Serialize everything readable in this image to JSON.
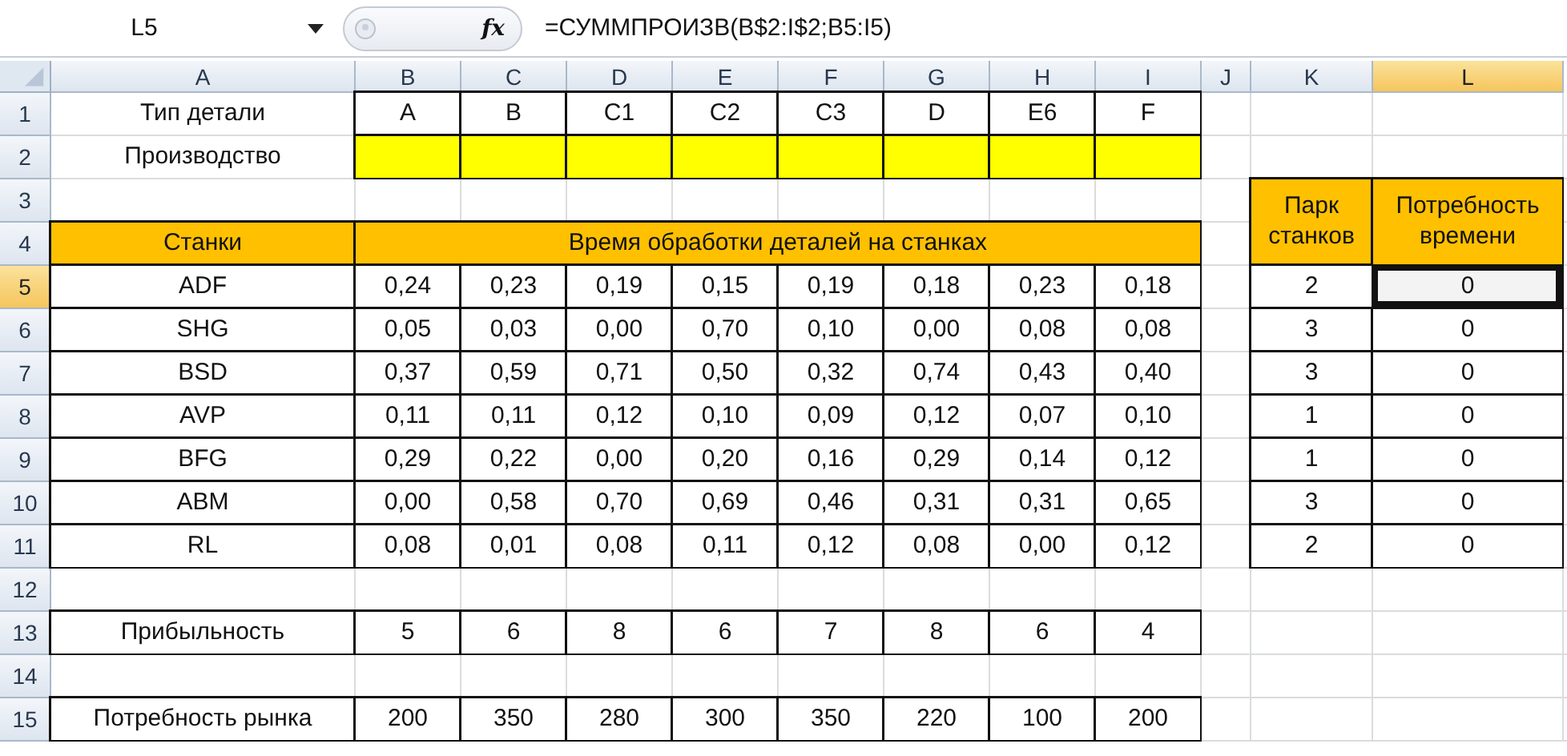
{
  "formula_bar": {
    "name_box": "L5",
    "function_label": "fx",
    "formula": "=СУММПРОИЗВ(B$2:I$2;B5:I5)"
  },
  "columns": [
    {
      "label": "A",
      "selected": false
    },
    {
      "label": "B",
      "selected": false
    },
    {
      "label": "C",
      "selected": false
    },
    {
      "label": "D",
      "selected": false
    },
    {
      "label": "E",
      "selected": false
    },
    {
      "label": "F",
      "selected": false
    },
    {
      "label": "G",
      "selected": false
    },
    {
      "label": "H",
      "selected": false
    },
    {
      "label": "I",
      "selected": false
    },
    {
      "label": "J",
      "selected": false
    },
    {
      "label": "K",
      "selected": false
    },
    {
      "label": "L",
      "selected": true
    }
  ],
  "rows": [
    {
      "label": "1",
      "selected": false
    },
    {
      "label": "2",
      "selected": false
    },
    {
      "label": "3",
      "selected": false
    },
    {
      "label": "4",
      "selected": false
    },
    {
      "label": "5",
      "selected": true
    },
    {
      "label": "6",
      "selected": false
    },
    {
      "label": "7",
      "selected": false
    },
    {
      "label": "8",
      "selected": false
    },
    {
      "label": "9",
      "selected": false
    },
    {
      "label": "10",
      "selected": false
    },
    {
      "label": "11",
      "selected": false
    },
    {
      "label": "12",
      "selected": false
    },
    {
      "label": "13",
      "selected": false
    },
    {
      "label": "14",
      "selected": false
    },
    {
      "label": "15",
      "selected": false
    }
  ],
  "table": {
    "part_type": {
      "label": "Тип детали",
      "parts": [
        "A",
        "B",
        "C1",
        "C2",
        "C3",
        "D",
        "E6",
        "F"
      ]
    },
    "production": {
      "label": "Производство"
    },
    "machines_header": "Станки",
    "times_header": "Время обработки деталей на станках",
    "fleet_header": "Парк станков",
    "need_header": "Потребность времени",
    "machines": [
      {
        "name": "ADF",
        "times": [
          "0,24",
          "0,23",
          "0,19",
          "0,15",
          "0,19",
          "0,18",
          "0,23",
          "0,18"
        ],
        "fleet": "2",
        "need": "0",
        "need_selected": true
      },
      {
        "name": "SHG",
        "times": [
          "0,05",
          "0,03",
          "0,00",
          "0,70",
          "0,10",
          "0,00",
          "0,08",
          "0,08"
        ],
        "fleet": "3",
        "need": "0",
        "need_selected": false
      },
      {
        "name": "BSD",
        "times": [
          "0,37",
          "0,59",
          "0,71",
          "0,50",
          "0,32",
          "0,74",
          "0,43",
          "0,40"
        ],
        "fleet": "3",
        "need": "0",
        "need_selected": false
      },
      {
        "name": "AVP",
        "times": [
          "0,11",
          "0,11",
          "0,12",
          "0,10",
          "0,09",
          "0,12",
          "0,07",
          "0,10"
        ],
        "fleet": "1",
        "need": "0",
        "need_selected": false
      },
      {
        "name": "BFG",
        "times": [
          "0,29",
          "0,22",
          "0,00",
          "0,20",
          "0,16",
          "0,29",
          "0,14",
          "0,12"
        ],
        "fleet": "1",
        "need": "0",
        "need_selected": false
      },
      {
        "name": "ABM",
        "times": [
          "0,00",
          "0,58",
          "0,70",
          "0,69",
          "0,46",
          "0,31",
          "0,31",
          "0,65"
        ],
        "fleet": "3",
        "need": "0",
        "need_selected": false
      },
      {
        "name": "RL",
        "times": [
          "0,08",
          "0,01",
          "0,08",
          "0,11",
          "0,12",
          "0,08",
          "0,00",
          "0,12"
        ],
        "fleet": "2",
        "need": "0",
        "need_selected": false
      }
    ],
    "profit": {
      "label": "Прибыльность",
      "values": [
        "5",
        "6",
        "8",
        "6",
        "7",
        "8",
        "6",
        "4"
      ]
    },
    "market": {
      "label": "Потребность рынка",
      "values": [
        "200",
        "350",
        "280",
        "300",
        "350",
        "220",
        "100",
        "200"
      ]
    }
  }
}
